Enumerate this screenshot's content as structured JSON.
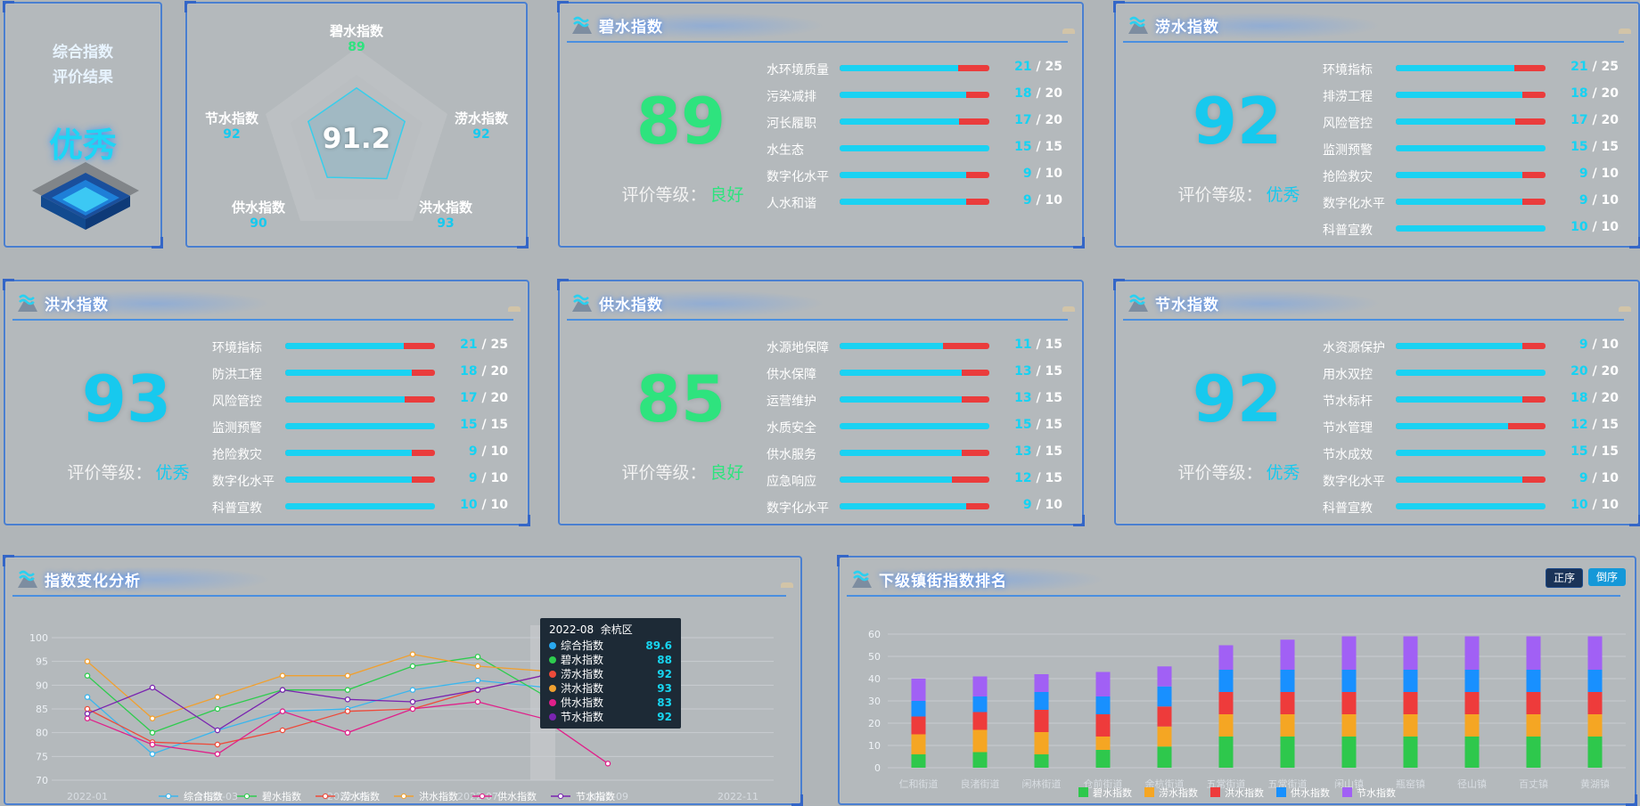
{
  "summary": {
    "title1": "综合指数",
    "title2": "评价结果",
    "result": "优秀"
  },
  "radar": {
    "center": "91.2",
    "axes": [
      {
        "label": "碧水指数",
        "value": "89",
        "color": "#2ee37e"
      },
      {
        "label": "涝水指数",
        "value": "92",
        "color": "#17c9ee"
      },
      {
        "label": "洪水指数",
        "value": "93",
        "color": "#17c9ee"
      },
      {
        "label": "供水指数",
        "value": "90",
        "color": "#17c9ee"
      },
      {
        "label": "节水指数",
        "value": "92",
        "color": "#17c9ee"
      }
    ]
  },
  "grade_label": "评价等级：",
  "cards": [
    {
      "title": "碧水指数",
      "score": "89",
      "grade": "良好",
      "color": "#2ee37e",
      "rows": [
        {
          "label": "水环境质量",
          "v": "21",
          "m": "25"
        },
        {
          "label": "污染减排",
          "v": "18",
          "m": "20"
        },
        {
          "label": "河长履职",
          "v": "17",
          "m": "20"
        },
        {
          "label": "水生态",
          "v": "15",
          "m": "15"
        },
        {
          "label": "数字化水平",
          "v": "9",
          "m": "10"
        },
        {
          "label": "人水和谐",
          "v": "9",
          "m": "10"
        }
      ]
    },
    {
      "title": "涝水指数",
      "score": "92",
      "grade": "优秀",
      "color": "#17c9ee",
      "rows": [
        {
          "label": "环境指标",
          "v": "21",
          "m": "25"
        },
        {
          "label": "排涝工程",
          "v": "18",
          "m": "20"
        },
        {
          "label": "风险管控",
          "v": "17",
          "m": "20"
        },
        {
          "label": "监测预警",
          "v": "15",
          "m": "15"
        },
        {
          "label": "抢险救灾",
          "v": "9",
          "m": "10"
        },
        {
          "label": "数字化水平",
          "v": "9",
          "m": "10"
        },
        {
          "label": "科普宣教",
          "v": "10",
          "m": "10"
        }
      ]
    },
    {
      "title": "洪水指数",
      "score": "93",
      "grade": "优秀",
      "color": "#17c9ee",
      "rows": [
        {
          "label": "环境指标",
          "v": "21",
          "m": "25"
        },
        {
          "label": "防洪工程",
          "v": "18",
          "m": "20"
        },
        {
          "label": "风险管控",
          "v": "17",
          "m": "20"
        },
        {
          "label": "监测预警",
          "v": "15",
          "m": "15"
        },
        {
          "label": "抢险救灾",
          "v": "9",
          "m": "10"
        },
        {
          "label": "数字化水平",
          "v": "9",
          "m": "10"
        },
        {
          "label": "科普宣教",
          "v": "10",
          "m": "10"
        }
      ]
    },
    {
      "title": "供水指数",
      "score": "85",
      "grade": "良好",
      "color": "#2ee37e",
      "rows": [
        {
          "label": "水源地保障",
          "v": "11",
          "m": "15"
        },
        {
          "label": "供水保障",
          "v": "13",
          "m": "15"
        },
        {
          "label": "运营维护",
          "v": "13",
          "m": "15"
        },
        {
          "label": "水质安全",
          "v": "15",
          "m": "15"
        },
        {
          "label": "供水服务",
          "v": "13",
          "m": "15"
        },
        {
          "label": "应急响应",
          "v": "12",
          "m": "15"
        },
        {
          "label": "数字化水平",
          "v": "9",
          "m": "10"
        }
      ]
    },
    {
      "title": "节水指数",
      "score": "92",
      "grade": "优秀",
      "color": "#17c9ee",
      "rows": [
        {
          "label": "水资源保护",
          "v": "9",
          "m": "10"
        },
        {
          "label": "用水双控",
          "v": "20",
          "m": "20"
        },
        {
          "label": "节水标杆",
          "v": "18",
          "m": "20"
        },
        {
          "label": "节水管理",
          "v": "12",
          "m": "15"
        },
        {
          "label": "节水成效",
          "v": "15",
          "m": "15"
        },
        {
          "label": "数字化水平",
          "v": "9",
          "m": "10"
        },
        {
          "label": "科普宣教",
          "v": "10",
          "m": "10"
        }
      ]
    }
  ],
  "line_panel": {
    "title": "指数变化分析"
  },
  "bar_panel": {
    "title": "下级镇街指数排名",
    "btn_asc": "正序",
    "btn_desc": "倒序"
  },
  "tooltip": {
    "header": "2022-08  余杭区",
    "items": [
      {
        "name": "综合指数",
        "value": "89.6",
        "color": "#29a8ef"
      },
      {
        "name": "碧水指数",
        "value": "88",
        "color": "#2ecc4e"
      },
      {
        "name": "涝水指数",
        "value": "92",
        "color": "#ee4a3a"
      },
      {
        "name": "洪水指数",
        "value": "93",
        "color": "#f0a030"
      },
      {
        "name": "供水指数",
        "value": "83",
        "color": "#e0208a"
      },
      {
        "name": "节水指数",
        "value": "92",
        "color": "#7a24b0"
      }
    ]
  },
  "chart_data": [
    {
      "type": "line",
      "x": [
        "2022-01",
        "2022-02",
        "2022-03",
        "2022-04",
        "2022-05",
        "2022-06",
        "2022-07",
        "2022-08",
        "2022-09"
      ],
      "xticks": [
        "2022-01",
        "2022-03",
        "2022-05",
        "2022-07",
        "2022-09",
        "2022-11"
      ],
      "ylim": [
        70,
        100
      ],
      "yticks": [
        70,
        75,
        80,
        85,
        90,
        95,
        100
      ],
      "series": [
        {
          "name": "综合指数",
          "color": "#3ab6ee",
          "values": [
            87.5,
            75.5,
            80.5,
            84.5,
            85,
            89,
            91,
            89.6,
            null
          ]
        },
        {
          "name": "碧水指数",
          "color": "#2ecc4e",
          "values": [
            92,
            80,
            85,
            89,
            89,
            94,
            96,
            88,
            null
          ]
        },
        {
          "name": "涝水指数",
          "color": "#ee4a3a",
          "values": [
            85,
            78,
            77.5,
            80.5,
            84.5,
            85,
            89,
            92,
            null
          ]
        },
        {
          "name": "洪水指数",
          "color": "#f0a030",
          "values": [
            95,
            83,
            87.5,
            92,
            92,
            96.5,
            94,
            93,
            null
          ]
        },
        {
          "name": "供水指数",
          "color": "#e0208a",
          "values": [
            83,
            77.5,
            75.5,
            84.5,
            80,
            85,
            86.5,
            83,
            73.5
          ]
        },
        {
          "name": "节水指数",
          "color": "#7a24b0",
          "values": [
            84,
            89.5,
            80.5,
            89,
            87,
            86.5,
            89,
            92,
            null
          ]
        }
      ],
      "legend": "bottom",
      "grid": true
    },
    {
      "type": "bar",
      "stacked": true,
      "categories": [
        "仁和街道",
        "良渚街道",
        "闲林街道",
        "仓前街道",
        "余杭街道",
        "五常街道",
        "五常街道",
        "闲山镇",
        "瓶窑镇",
        "径山镇",
        "百丈镇",
        "黄湖镇"
      ],
      "ylim": [
        0,
        60
      ],
      "yticks": [
        0,
        10,
        20,
        30,
        40,
        50,
        60
      ],
      "series": [
        {
          "name": "碧水指数",
          "color": "#2ec84c",
          "values": [
            6,
            7,
            6,
            8,
            9.5,
            14,
            14,
            14,
            14,
            14,
            14,
            14
          ]
        },
        {
          "name": "涝水指数",
          "color": "#f5a623",
          "values": [
            9,
            10,
            10,
            6,
            9,
            10,
            10,
            10,
            10,
            10,
            10,
            10
          ]
        },
        {
          "name": "洪水指数",
          "color": "#ee3b3b",
          "values": [
            8,
            8,
            10,
            10,
            9,
            10,
            10,
            10,
            10,
            10,
            10,
            10
          ]
        },
        {
          "name": "供水指数",
          "color": "#1890ff",
          "values": [
            7,
            7,
            8,
            8,
            9,
            10,
            10,
            10,
            10,
            10,
            10,
            10
          ]
        },
        {
          "name": "节水指数",
          "color": "#a160f5",
          "values": [
            10,
            9,
            8,
            11,
            9,
            11,
            13.5,
            15,
            15,
            15,
            15,
            15
          ]
        }
      ],
      "legend": "bottom"
    }
  ]
}
